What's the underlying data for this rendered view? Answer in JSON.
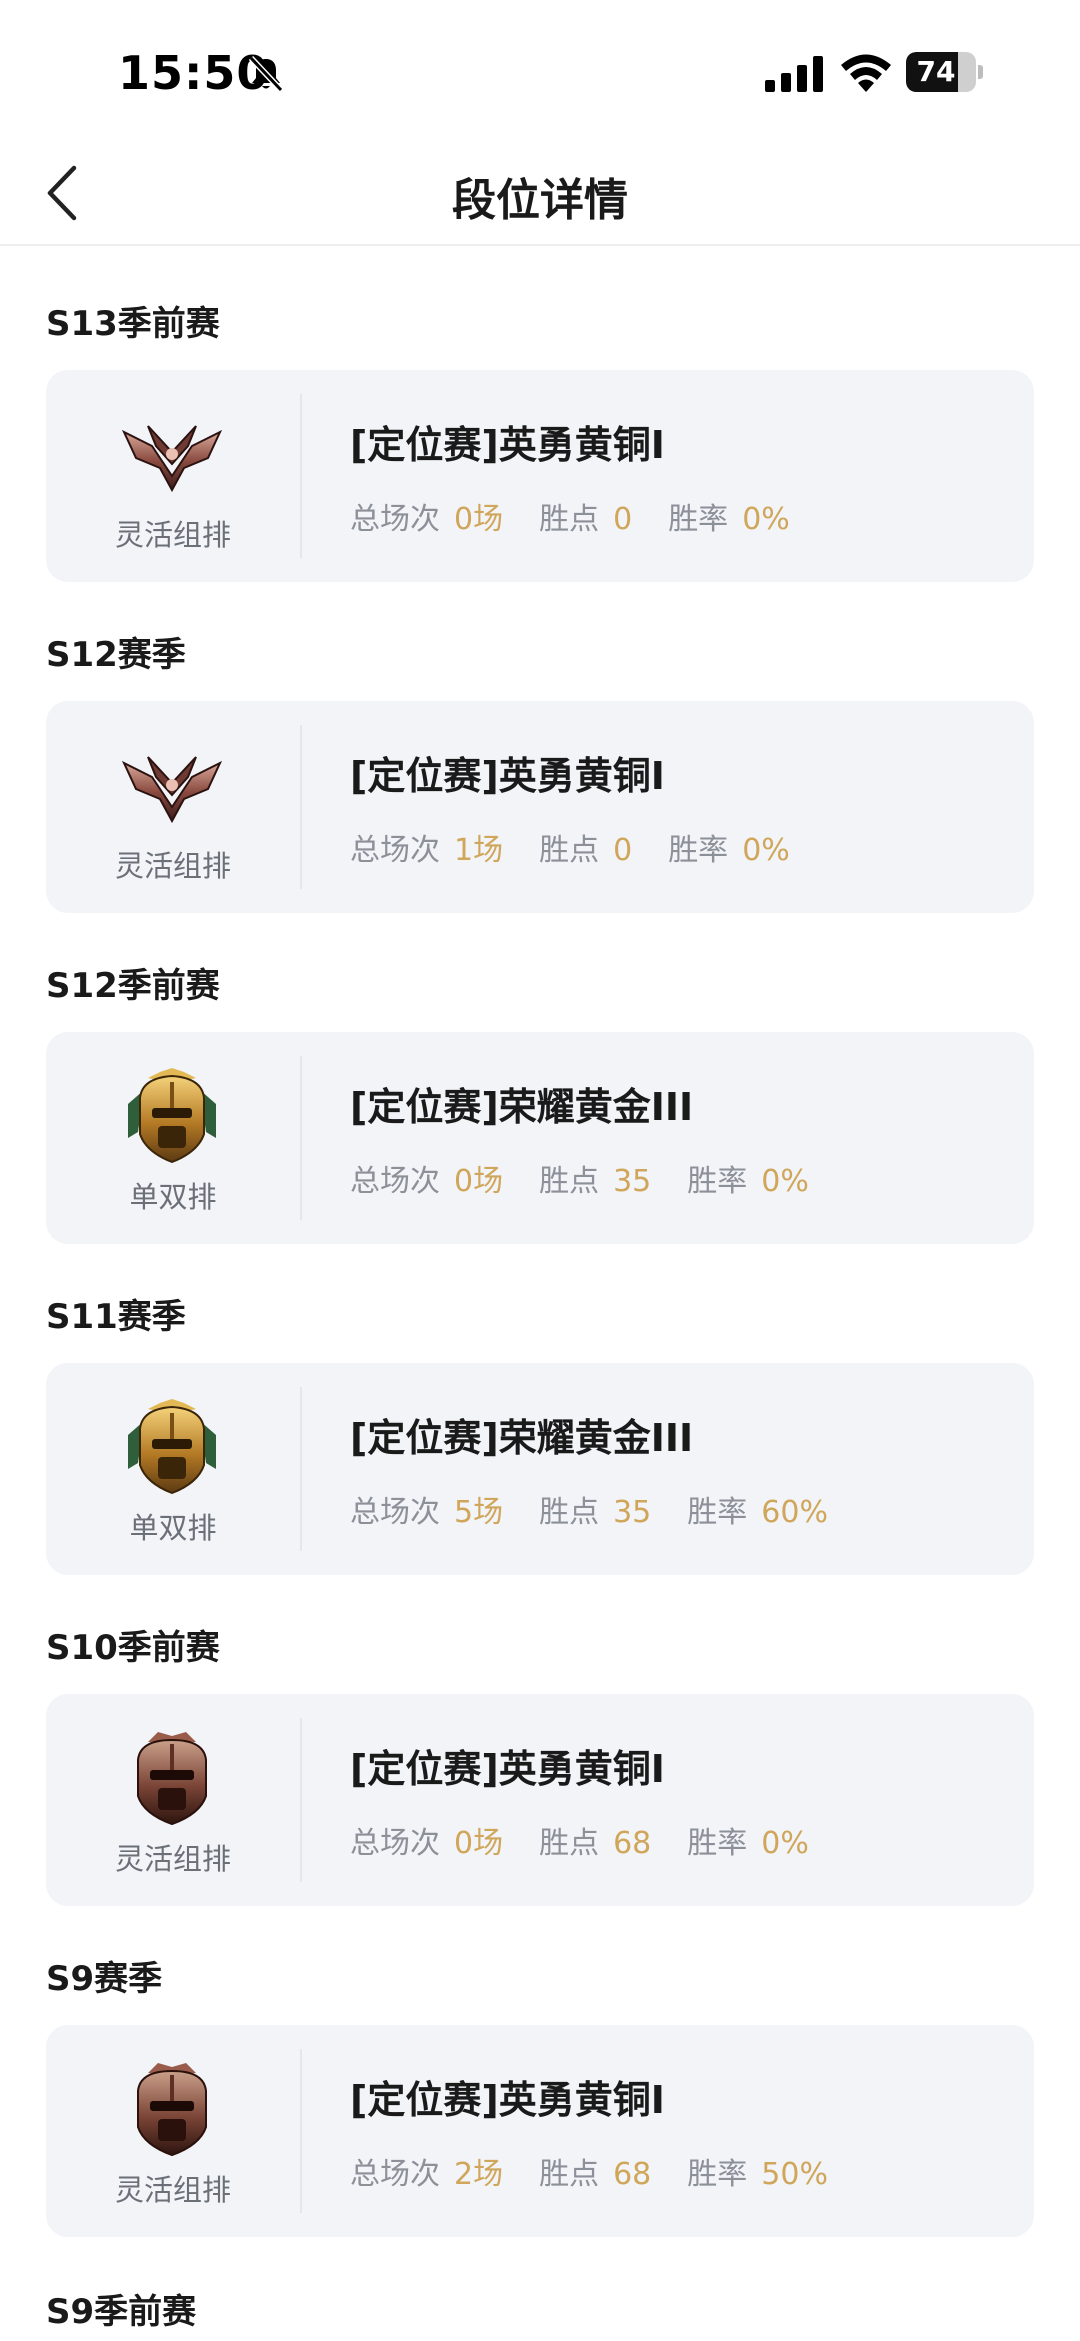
{
  "status_bar": {
    "time": "15:50",
    "battery": "74",
    "battery_level": 0.74
  },
  "header": {
    "title": "段位详情"
  },
  "labels": {
    "total_games": "总场次",
    "points": "胜点",
    "win_rate": "胜率"
  },
  "seasons": [
    {
      "title": "S13季前赛",
      "badge": "bronze-wings-icon",
      "queue": "灵活组排",
      "rank": "[定位赛]英勇黄铜I",
      "games": "0场",
      "points": "0",
      "win_rate": "0%"
    },
    {
      "title": "S12赛季",
      "badge": "bronze-wings-icon",
      "queue": "灵活组排",
      "rank": "[定位赛]英勇黄铜I",
      "games": "1场",
      "points": "0",
      "win_rate": "0%"
    },
    {
      "title": "S12季前赛",
      "badge": "gold-helmet-icon",
      "queue": "单双排",
      "rank": "[定位赛]荣耀黄金III",
      "games": "0场",
      "points": "35",
      "win_rate": "0%"
    },
    {
      "title": "S11赛季",
      "badge": "gold-helmet-icon",
      "queue": "单双排",
      "rank": "[定位赛]荣耀黄金III",
      "games": "5场",
      "points": "35",
      "win_rate": "60%"
    },
    {
      "title": "S10季前赛",
      "badge": "bronze-helmet-icon",
      "queue": "灵活组排",
      "rank": "[定位赛]英勇黄铜I",
      "games": "0场",
      "points": "68",
      "win_rate": "0%"
    },
    {
      "title": "S9赛季",
      "badge": "bronze-helmet-icon",
      "queue": "灵活组排",
      "rank": "[定位赛]英勇黄铜I",
      "games": "2场",
      "points": "68",
      "win_rate": "50%"
    }
  ],
  "next_season_title": "S9季前赛",
  "colors": {
    "accent": "#d0a65a",
    "card_bg": "#f2f4f8",
    "label": "#8c9098"
  }
}
